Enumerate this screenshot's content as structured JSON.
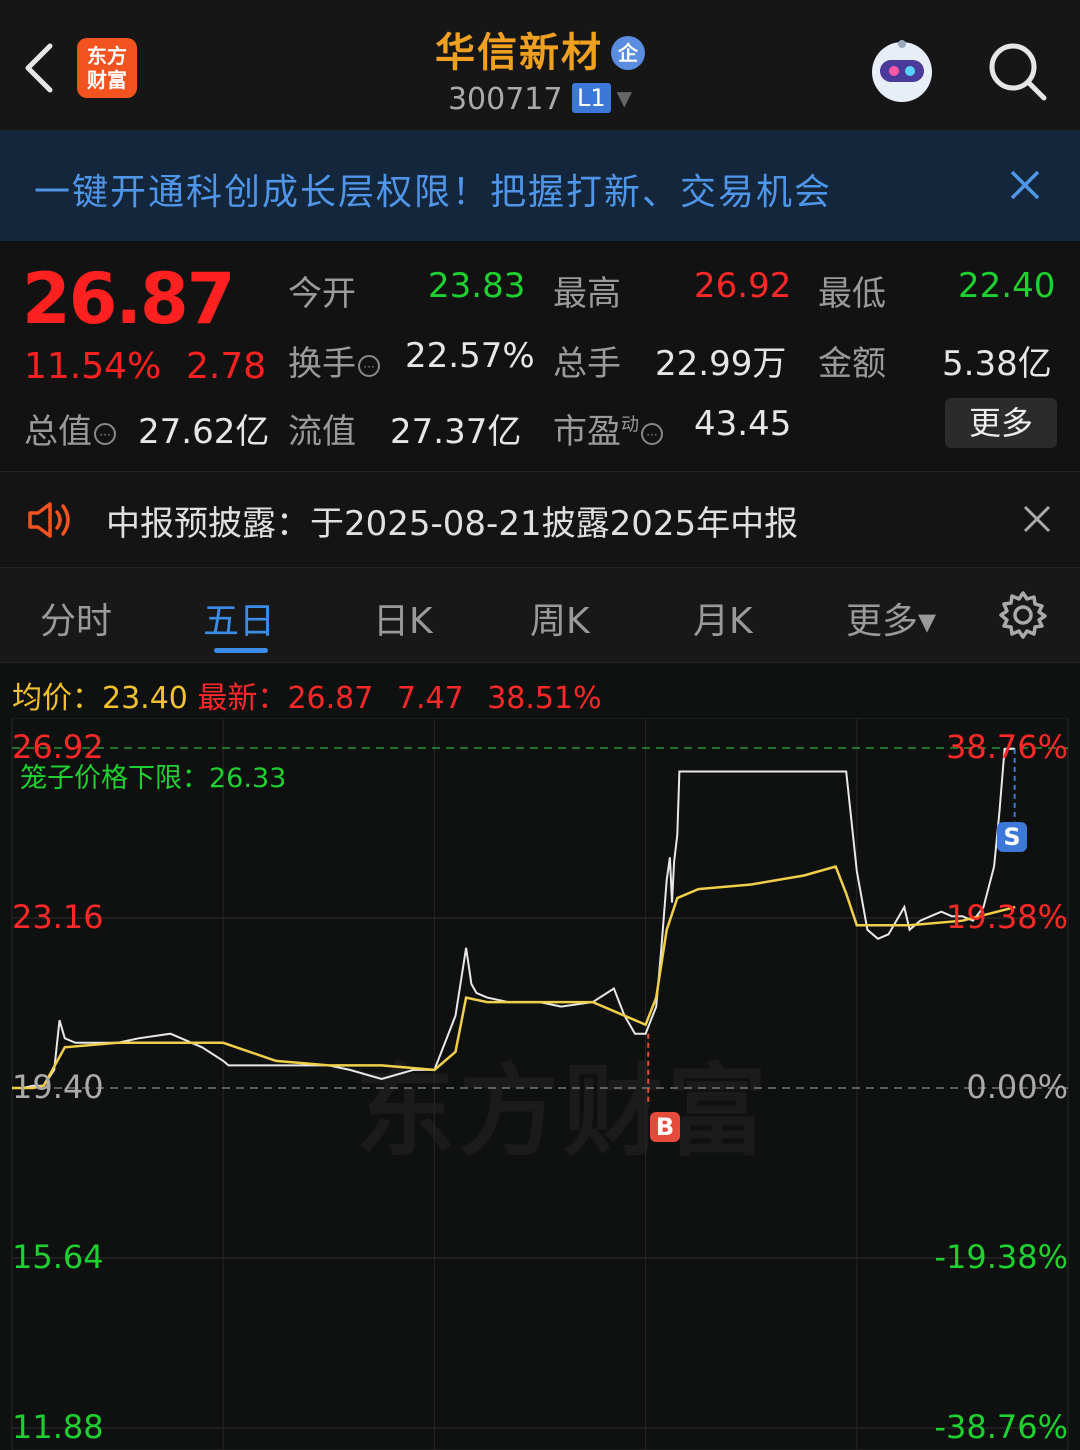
{
  "header": {
    "logo_text": "东方\n财富",
    "stock_name": "华信新材",
    "badge": "企",
    "stock_code": "300717",
    "level": "L1",
    "icons": [
      "back-arrow-icon",
      "app-logo",
      "robot-assistant-icon",
      "search-icon"
    ]
  },
  "banner": {
    "text": "一键开通科创成长层权限！把握打新、交易机会"
  },
  "quote": {
    "price": "26.87",
    "change_pct": "11.54%",
    "change": "2.78",
    "open_label": "今开",
    "open": "23.83",
    "high_label": "最高",
    "high": "26.92",
    "low_label": "最低",
    "low": "22.40",
    "turnover_label": "换手",
    "turnover": "22.57%",
    "volume_label": "总手",
    "volume": "22.99万",
    "amount_label": "金额",
    "amount": "5.38亿",
    "mktcap_label": "总值",
    "mktcap": "27.62亿",
    "float_label": "流值",
    "float": "27.37亿",
    "pe_label": "市盈",
    "pe_sup": "动",
    "pe": "43.45",
    "more": "更多",
    "colors": {
      "up": "#ff2828",
      "down": "#1ed030"
    }
  },
  "notice": {
    "text": "中报预披露：于2025-08-21披露2025年中报"
  },
  "tabs": {
    "items": [
      "分时",
      "五日",
      "日K",
      "周K",
      "月K",
      "更多▾"
    ],
    "active": "五日"
  },
  "info": {
    "avg_label": "均价：",
    "avg": "23.40",
    "latest_label": "最新：",
    "latest": "26.87",
    "change": "7.47",
    "change_pct": "38.51%"
  },
  "chart_data": {
    "type": "line",
    "title": "",
    "y_left_ticks": [
      "26.92",
      "23.16",
      "19.40",
      "15.64",
      "11.88"
    ],
    "y_right_ticks": [
      "38.76%",
      "19.38%",
      "0.00%",
      "-19.38%",
      "-38.76%"
    ],
    "ylim": [
      11.88,
      26.92
    ],
    "base_price": 19.4,
    "limit_label": "笼子价格下限：26.33",
    "days": 5,
    "series": [
      {
        "name": "price",
        "color": "#e8e8e8",
        "x": [
          0,
          0.01,
          0.02,
          0.03,
          0.04,
          0.045,
          0.05,
          0.06,
          0.08,
          0.1,
          0.12,
          0.15,
          0.18,
          0.2,
          0.205,
          0.22,
          0.25,
          0.28,
          0.3,
          0.32,
          0.35,
          0.38,
          0.4,
          0.42,
          0.43,
          0.435,
          0.44,
          0.45,
          0.47,
          0.5,
          0.52,
          0.55,
          0.57,
          0.58,
          0.585,
          0.59,
          0.6,
          0.61,
          0.615,
          0.62,
          0.623,
          0.625,
          0.627,
          0.63,
          0.632,
          0.635,
          0.64,
          0.65,
          0.66,
          0.68,
          0.7,
          0.72,
          0.74,
          0.76,
          0.78,
          0.785,
          0.79,
          0.8,
          0.81,
          0.82,
          0.83,
          0.84,
          0.845,
          0.85,
          0.86,
          0.87,
          0.88,
          0.89,
          0.9,
          0.91,
          0.92,
          0.93,
          0.935,
          0.94,
          0.945,
          0.95
        ],
        "y": [
          19.4,
          19.4,
          19.45,
          19.45,
          19.8,
          20.9,
          20.5,
          20.4,
          20.4,
          20.4,
          20.5,
          20.6,
          20.3,
          20.0,
          19.9,
          19.9,
          19.9,
          19.9,
          19.9,
          19.8,
          19.6,
          19.8,
          19.8,
          21.0,
          22.5,
          21.7,
          21.5,
          21.4,
          21.3,
          21.3,
          21.2,
          21.3,
          21.6,
          21.0,
          20.8,
          20.6,
          20.6,
          21.2,
          22.5,
          24.0,
          24.5,
          23.5,
          24.4,
          25.0,
          26.4,
          26.4,
          26.4,
          26.4,
          26.4,
          26.4,
          26.4,
          26.4,
          26.4,
          26.4,
          26.4,
          26.4,
          26.4,
          24.2,
          22.9,
          22.7,
          22.8,
          23.2,
          23.4,
          22.9,
          23.1,
          23.2,
          23.3,
          23.2,
          23.2,
          23.1,
          23.4,
          24.3,
          25.5,
          26.9,
          26.9,
          26.9
        ]
      },
      {
        "name": "avg",
        "color": "#f0cf4a",
        "x": [
          0,
          0.01,
          0.02,
          0.03,
          0.05,
          0.1,
          0.15,
          0.2,
          0.25,
          0.3,
          0.35,
          0.4,
          0.42,
          0.43,
          0.45,
          0.5,
          0.55,
          0.58,
          0.6,
          0.61,
          0.62,
          0.63,
          0.65,
          0.7,
          0.75,
          0.78,
          0.79,
          0.8,
          0.85,
          0.9,
          0.95
        ],
        "y": [
          19.4,
          19.4,
          19.4,
          19.45,
          20.3,
          20.4,
          20.4,
          20.4,
          20.0,
          19.9,
          19.9,
          19.8,
          20.2,
          21.4,
          21.3,
          21.3,
          21.3,
          21.0,
          20.8,
          21.4,
          22.9,
          23.6,
          23.8,
          23.9,
          24.1,
          24.3,
          23.7,
          23.0,
          23.0,
          23.1,
          23.4
        ]
      }
    ]
  }
}
